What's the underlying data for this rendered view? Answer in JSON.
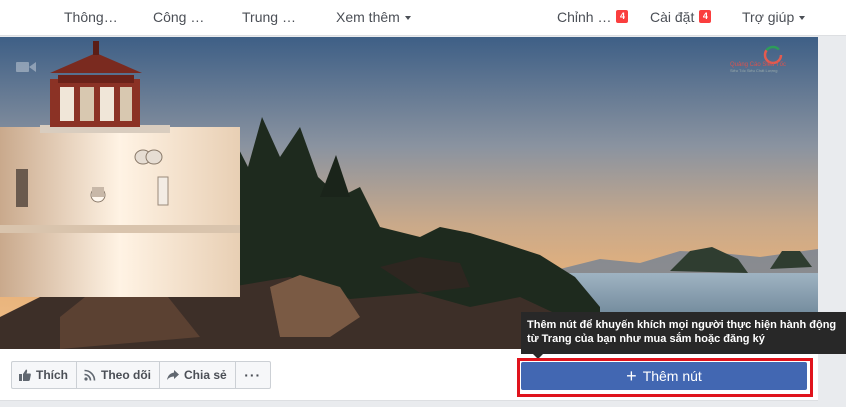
{
  "nav": {
    "left": [
      {
        "label": "Thông…"
      },
      {
        "label": "Công …"
      },
      {
        "label": "Trung …"
      },
      {
        "label": "Xem thêm"
      }
    ],
    "right": [
      {
        "label": "Chỉnh …",
        "badge": "4"
      },
      {
        "label": "Cài đặt",
        "badge": "4"
      },
      {
        "label": "Trợ giúp"
      }
    ]
  },
  "watermark": {
    "title": "Quảng Cáo Siêu Tốc",
    "subtitle": "Siêu Tốc Siêu Chất Lượng"
  },
  "actions": {
    "like": "Thích",
    "follow": "Theo dõi",
    "share": "Chia sẻ",
    "more": "···"
  },
  "add_button": {
    "plus": "+",
    "label": "Thêm nút"
  },
  "tooltip": {
    "line1": "Thêm nút để khuyến khích mọi người thực hiện hành động",
    "line2": "từ Trang của bạn như mua sắm hoặc đăng ký"
  },
  "colors": {
    "primary": "#4267b2",
    "highlight": "#e0131c",
    "badge": "#fa3e3e",
    "tooltip_bg": "#282828"
  }
}
